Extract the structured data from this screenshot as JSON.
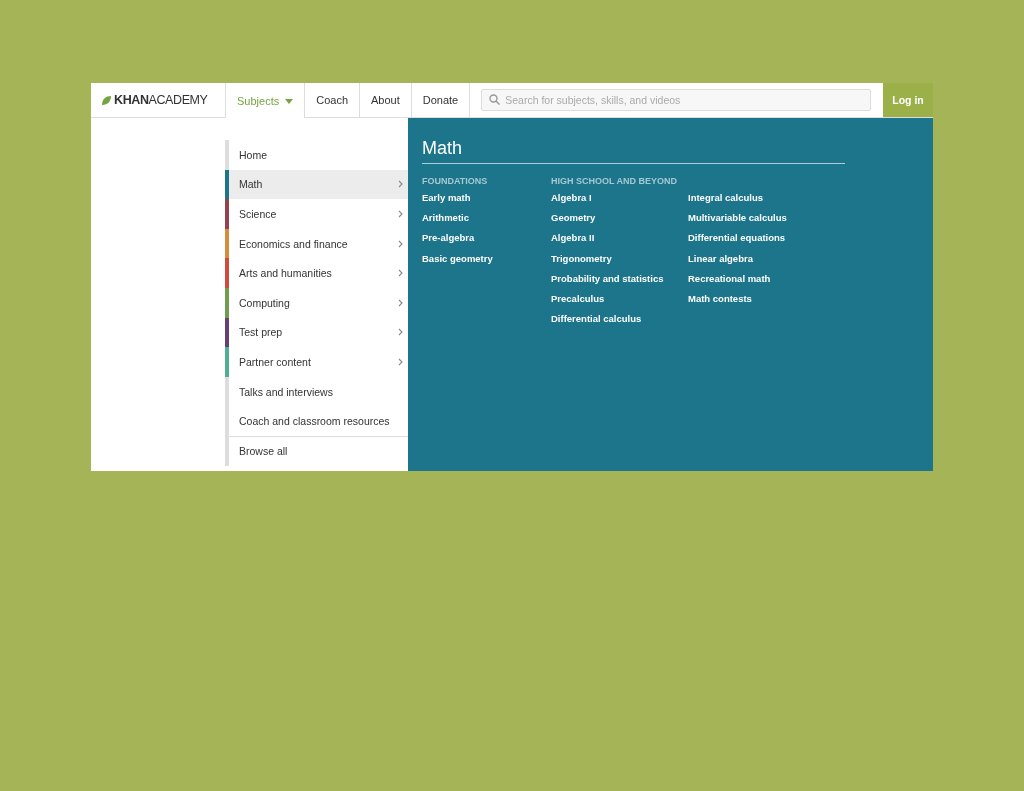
{
  "header": {
    "logo": "**KHAN**ACADEMY",
    "nav": [
      {
        "label": "Subjects",
        "selected": true,
        "dropdown": true
      },
      {
        "label": "Coach",
        "selected": false,
        "dropdown": false
      },
      {
        "label": "About",
        "selected": false,
        "dropdown": false
      },
      {
        "label": "Donate",
        "selected": false,
        "dropdown": false
      }
    ],
    "search": {
      "placeholder": "Search for subjects, skills, and videos"
    },
    "login": "Log in"
  },
  "menu": [
    {
      "label": "Home",
      "color": "#dddddd",
      "selected": false,
      "has_submenu": false
    },
    {
      "label": "Math",
      "color": "#1c758a",
      "selected": true,
      "has_submenu": true
    },
    {
      "label": "Science",
      "color": "#94424f",
      "selected": false,
      "has_submenu": true
    },
    {
      "label": "Economics and finance",
      "color": "#d48d3c",
      "selected": false,
      "has_submenu": true
    },
    {
      "label": "Arts and humanities",
      "color": "#d04b3e",
      "selected": false,
      "has_submenu": true
    },
    {
      "label": "Computing",
      "color": "#6f9c4e",
      "selected": false,
      "has_submenu": true
    },
    {
      "label": "Test prep",
      "color": "#644172",
      "selected": false,
      "has_submenu": true
    },
    {
      "label": "Partner content",
      "color": "#4fae93",
      "selected": false,
      "has_submenu": true
    },
    {
      "label": "Talks and interviews",
      "color": "#dddddd",
      "selected": false,
      "has_submenu": false
    },
    {
      "label": "Coach and classroom resources",
      "color": "#dddddd",
      "selected": false,
      "has_submenu": false
    },
    {
      "label": "Browse all",
      "color": "#dddddd",
      "selected": false,
      "has_submenu": false,
      "separated": true
    }
  ],
  "panel": {
    "title": "Math",
    "groups": [
      {
        "heading": "FOUNDATIONS",
        "columns": [
          [
            "Early math",
            "Arithmetic",
            "Pre-algebra",
            "Basic geometry"
          ]
        ]
      },
      {
        "heading": "HIGH SCHOOL AND BEYOND",
        "columns": [
          [
            "Algebra I",
            "Geometry",
            "Algebra II",
            "Trigonometry",
            "Probability and statistics",
            "Precalculus",
            "Differential calculus"
          ],
          [
            "Integral calculus",
            "Multivariable calculus",
            "Differential equations",
            "Linear algebra",
            "Recreational math",
            "Math contests"
          ]
        ]
      }
    ]
  }
}
